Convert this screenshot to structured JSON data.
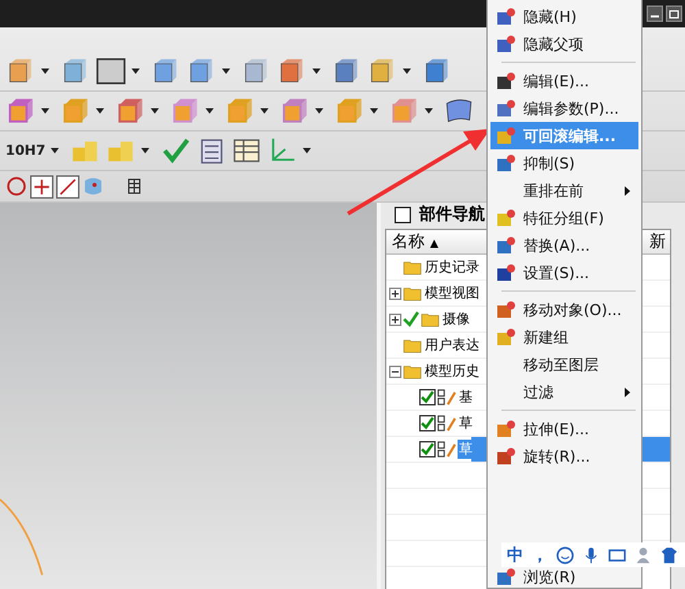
{
  "toolbar": {
    "tolerance_label": "10H7"
  },
  "navigator": {
    "title": "部件导航",
    "columns": [
      {
        "label": "名称",
        "sort_mark": "▲"
      },
      {
        "label": "新"
      }
    ],
    "tree": [
      {
        "label": "历史记录",
        "selected": false
      },
      {
        "label": "模型视图",
        "selected": false,
        "expanded": false
      },
      {
        "label": "摄像",
        "selected": false,
        "expanded": false,
        "checked": true
      },
      {
        "label": "用户表达",
        "selected": false
      },
      {
        "label": "模型历史",
        "selected": false,
        "expanded": true,
        "children": [
          {
            "label": "基",
            "selected": false,
            "checked": true
          },
          {
            "label": "草",
            "selected": false,
            "checked": true
          },
          {
            "label": "草",
            "selected": true,
            "checked": true
          }
        ]
      }
    ]
  },
  "context_menu": {
    "items": [
      {
        "kind": "item",
        "label": "隐藏(H)",
        "selected": false
      },
      {
        "kind": "item",
        "label": "隐藏父项",
        "selected": false
      },
      {
        "kind": "separator"
      },
      {
        "kind": "item",
        "label": "编辑(E)...",
        "selected": false
      },
      {
        "kind": "item",
        "label": "编辑参数(P)...",
        "selected": false
      },
      {
        "kind": "item",
        "label": "可回滚编辑...",
        "selected": true
      },
      {
        "kind": "item",
        "label": "抑制(S)",
        "selected": false
      },
      {
        "kind": "submenu",
        "label": "重排在前",
        "selected": false
      },
      {
        "kind": "item",
        "label": "特征分组(F)",
        "selected": false
      },
      {
        "kind": "item",
        "label": "替换(A)...",
        "selected": false
      },
      {
        "kind": "item",
        "label": "设置(S)...",
        "selected": false
      },
      {
        "kind": "separator"
      },
      {
        "kind": "item",
        "label": "移动对象(O)...",
        "selected": false
      },
      {
        "kind": "item",
        "label": "新建组",
        "selected": false
      },
      {
        "kind": "item",
        "label": "移动至图层",
        "selected": false
      },
      {
        "kind": "submenu",
        "label": "过滤",
        "selected": false
      },
      {
        "kind": "separator"
      },
      {
        "kind": "item",
        "label": "拉伸(E)...",
        "selected": false
      },
      {
        "kind": "item",
        "label": "旋转(R)...",
        "selected": false
      },
      {
        "kind": "gap"
      },
      {
        "kind": "item",
        "label": "浏览(R)",
        "selected": false
      }
    ]
  },
  "ime_bar": {
    "items": [
      "中",
      "，"
    ]
  }
}
